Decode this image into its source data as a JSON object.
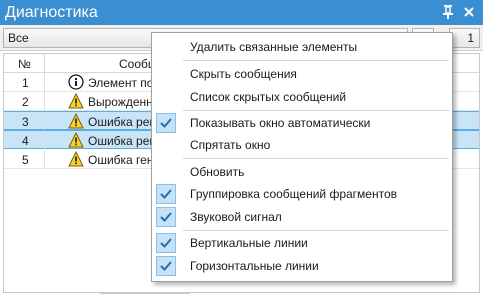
{
  "window": {
    "title": "Диагностика",
    "pin_icon": "pin-icon",
    "close_icon": "close-icon"
  },
  "toolbar": {
    "filter_value": "Все",
    "counter": "1"
  },
  "grid": {
    "columns": [
      "№",
      "Сообщение"
    ],
    "rows": [
      {
        "num": "1",
        "icon": "info-icon",
        "text": "Элемент под",
        "selected": false
      },
      {
        "num": "2",
        "icon": "warning-icon",
        "text": "Вырожденны",
        "selected": false
      },
      {
        "num": "3",
        "icon": "warning-icon",
        "text": "Ошибка реге",
        "selected": true
      },
      {
        "num": "4",
        "icon": "warning-icon",
        "text": "Ошибка реге",
        "selected": true
      },
      {
        "num": "5",
        "icon": "warning-icon",
        "text": "Ошибка гене",
        "selected": false
      }
    ]
  },
  "context_menu": {
    "items": [
      {
        "label": "Удалить связанные элементы",
        "checked": false
      },
      {
        "label": "Скрыть сообщения",
        "checked": false
      },
      {
        "label": "Список скрытых сообщений",
        "checked": false
      },
      {
        "label": "Показывать окно автоматически",
        "checked": true
      },
      {
        "label": "Спрятать окно",
        "checked": false
      },
      {
        "label": "Обновить",
        "checked": false
      },
      {
        "label": "Группировка сообщений фрагментов",
        "checked": true
      },
      {
        "label": "Звуковой сигнал",
        "checked": true
      },
      {
        "label": "Вертикальные линии",
        "checked": true
      },
      {
        "label": "Горизонтальные линии",
        "checked": true
      }
    ]
  },
  "colors": {
    "titlebar": "#3b8fd0",
    "selection": "#c9e4f6",
    "check_bg": "#c6e2f6",
    "check_mark": "#1f6fb5",
    "warning": "#f5d230",
    "info": "#1a1a1a"
  }
}
